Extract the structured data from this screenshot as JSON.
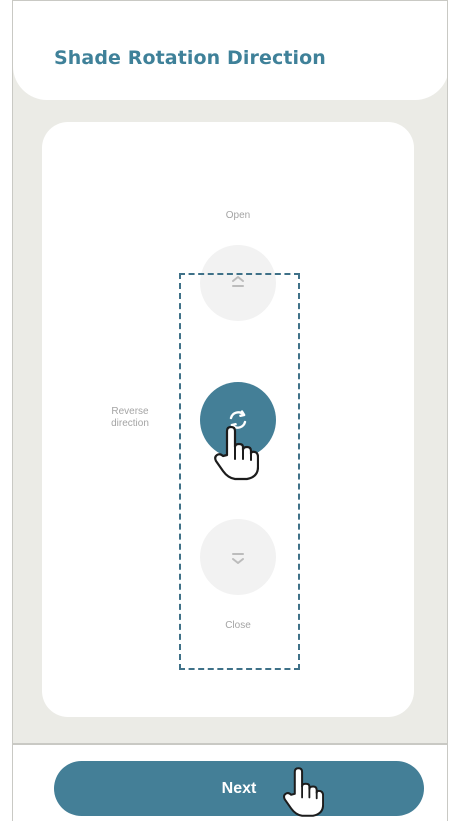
{
  "header": {
    "title": "Shade Rotation Direction"
  },
  "controls": {
    "open_label": "Open",
    "reverse_label_line1": "Reverse",
    "reverse_label_line2": "direction",
    "close_label": "Close",
    "open_icon": "chevrons-up-icon",
    "reverse_icon": "rotate-icon",
    "close_icon": "chevrons-down-icon"
  },
  "footer": {
    "next_label": "Next"
  },
  "colors": {
    "accent": "#447f97",
    "title": "#3f8199",
    "background": "#ebebe6",
    "button_inactive": "#f2f2f2",
    "highlight_border": "#3f7188"
  },
  "annotations": {
    "pointer_icon": "hand-pointer-icon"
  }
}
